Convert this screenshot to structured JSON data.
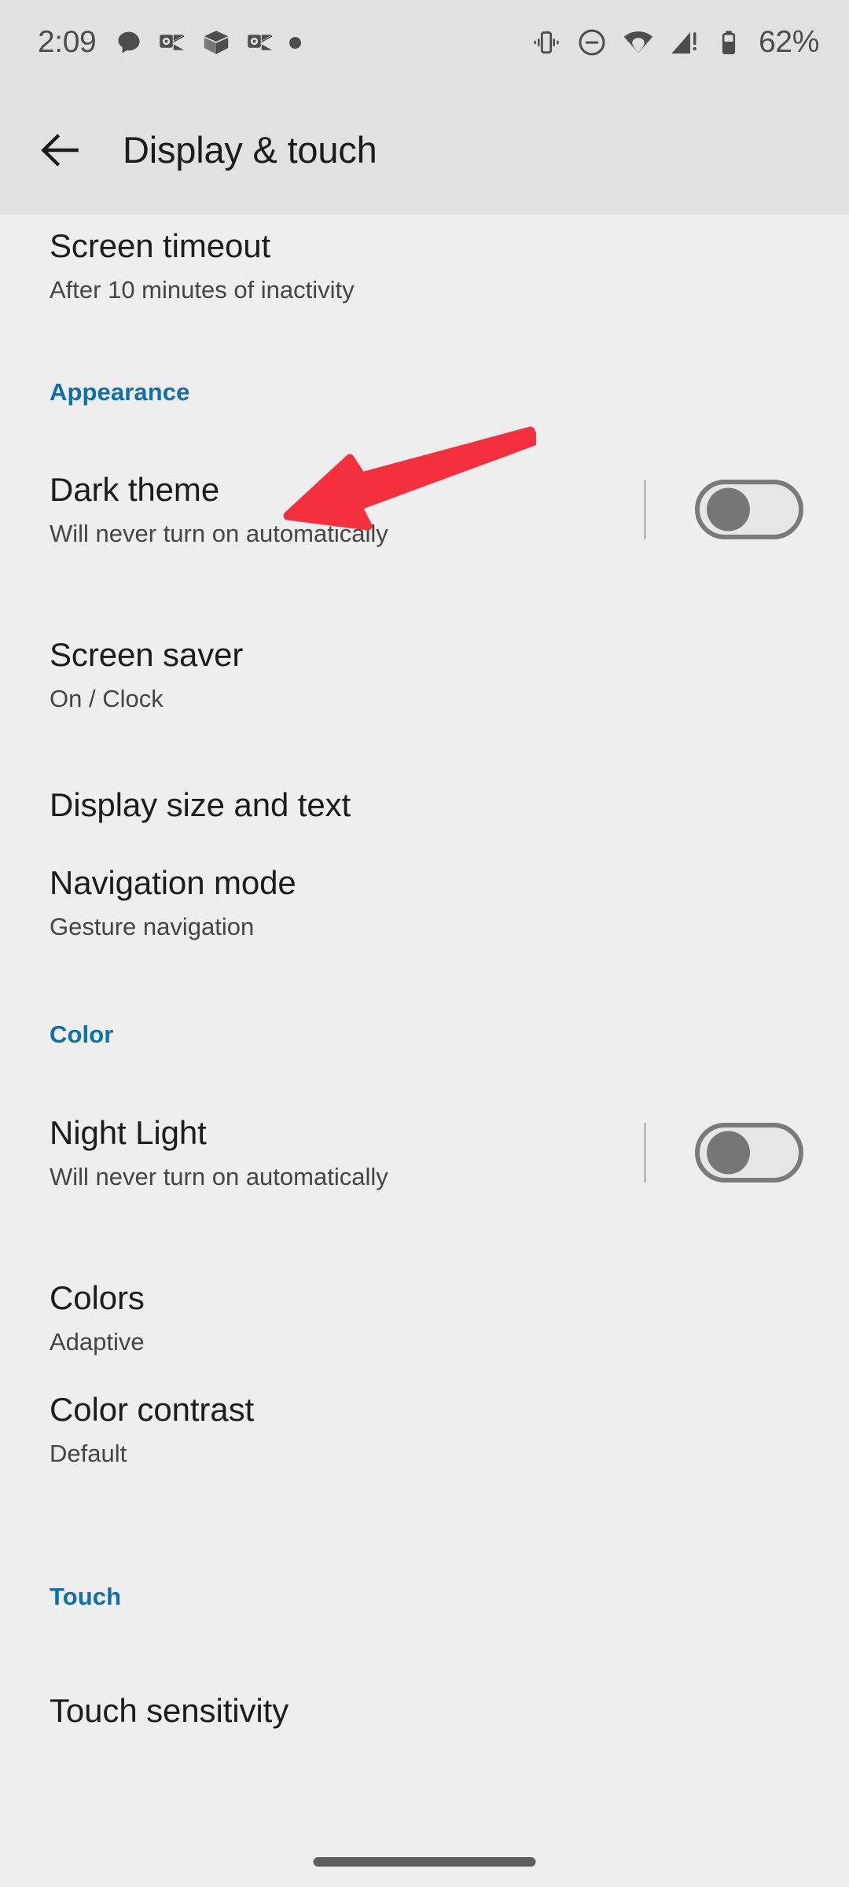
{
  "status_bar": {
    "clock": "2:09",
    "battery_percent": "62%",
    "left_icons": [
      "chat-bubble-icon",
      "outlook-icon",
      "package-box-icon",
      "outlook-icon",
      "notification-dot-icon"
    ],
    "right_icons": [
      "vibrate-icon",
      "do-not-disturb-icon",
      "wifi-icon",
      "cellular-signal-alert-icon",
      "battery-icon"
    ]
  },
  "toolbar": {
    "back_icon": "arrow-left-icon",
    "title": "Display & touch"
  },
  "colors": {
    "accent_blue": "#0f6fa8",
    "annotation_red": "#F4303F",
    "toolbar_background": "#e1e1e1",
    "content_background": "#eeeeee",
    "title_text": "#1c1c1c",
    "summary_text": "#454545"
  },
  "annotation": {
    "shape": "arrow",
    "color": "#F4303F",
    "points_to": "Dark theme"
  },
  "content": {
    "items": [
      {
        "type": "preference",
        "name": "screen-timeout",
        "title": "Screen timeout",
        "summary": "After 10 minutes of inactivity"
      },
      {
        "type": "section",
        "name": "appearance",
        "title": "Appearance"
      },
      {
        "type": "preference-switch",
        "name": "dark-theme",
        "title": "Dark theme",
        "summary": "Will never turn on automatically",
        "switch_state": "off"
      },
      {
        "type": "preference",
        "name": "screen-saver",
        "title": "Screen saver",
        "summary": "On / Clock"
      },
      {
        "type": "preference",
        "name": "display-size-and-text",
        "title": "Display size and text",
        "summary": ""
      },
      {
        "type": "preference",
        "name": "navigation-mode",
        "title": "Navigation mode",
        "summary": "Gesture navigation"
      },
      {
        "type": "section",
        "name": "color",
        "title": "Color"
      },
      {
        "type": "preference-switch",
        "name": "night-light",
        "title": "Night Light",
        "summary": "Will never turn on automatically",
        "switch_state": "off"
      },
      {
        "type": "preference",
        "name": "colors",
        "title": "Colors",
        "summary": "Adaptive"
      },
      {
        "type": "preference",
        "name": "color-contrast",
        "title": "Color contrast",
        "summary": "Default"
      },
      {
        "type": "section",
        "name": "touch",
        "title": "Touch"
      },
      {
        "type": "preference",
        "name": "touch-sensitivity",
        "title": "Touch sensitivity",
        "summary": ""
      }
    ]
  }
}
